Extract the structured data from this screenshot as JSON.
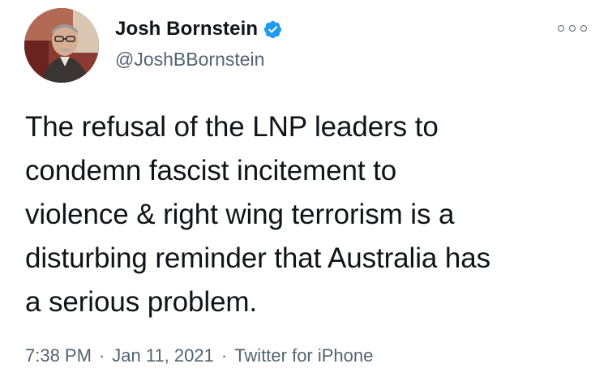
{
  "tweet": {
    "author": {
      "display_name": "Josh Bornstein",
      "handle": "@JoshBBornstein",
      "verified": true,
      "avatar_icon": "profile-photo"
    },
    "text": "The refusal of the LNP leaders to\ncondemn fascist incitement to\nviolence & right wing terrorism is a\ndisturbing reminder that Australia has\na serious problem.",
    "time": "7:38 PM",
    "separator": "·",
    "date": "Jan 11, 2021",
    "source": "Twitter for iPhone",
    "more_icon": "more-options-icon"
  },
  "colors": {
    "text_primary": "#0f1419",
    "text_secondary": "#536471",
    "verified_blue": "#1d9bf0",
    "background": "#ffffff"
  }
}
